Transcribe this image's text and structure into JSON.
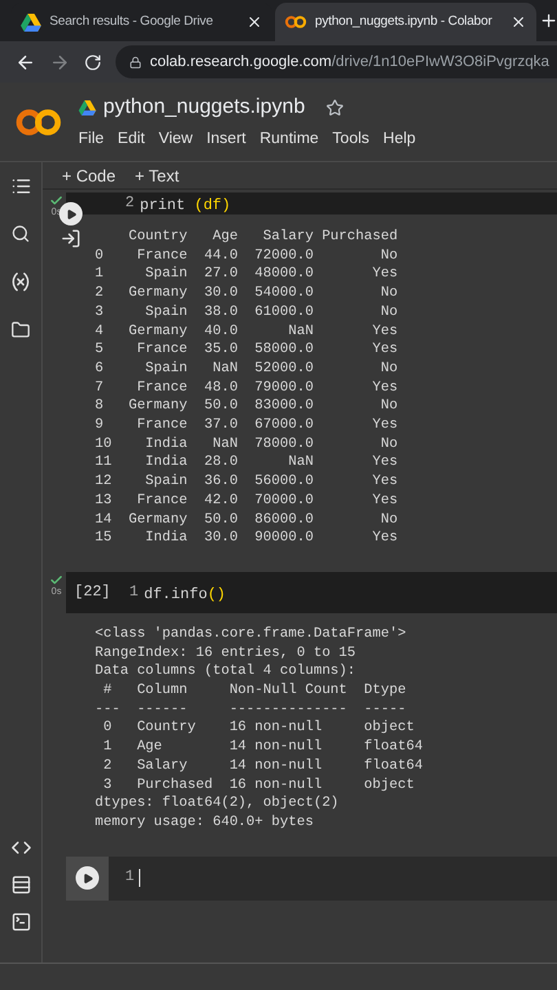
{
  "browser_tabs": [
    {
      "title": "Search results - Google Drive",
      "kind": "drive",
      "selected": false
    },
    {
      "title": "python_nuggets.ipynb - Colabor",
      "kind": "colab",
      "selected": true
    }
  ],
  "address_bar": {
    "host": "colab.research.google.com",
    "path": "/drive/1n10ePIwW3O8iPvgrzqka"
  },
  "notebook": {
    "title": "python_nuggets.ipynb",
    "menu": [
      "File",
      "Edit",
      "View",
      "Insert",
      "Runtime",
      "Tools",
      "Help"
    ]
  },
  "toolbar": [
    "+ Code",
    "+ Text"
  ],
  "cells": [
    {
      "kind": "scrolled",
      "status": "0s",
      "line_number": "2",
      "code": [
        {
          "text": "print ",
          "kind": "plain"
        },
        {
          "text": "(df)",
          "kind": "bracket"
        }
      ],
      "output": [
        "    Country   Age   Salary Purchased",
        "0    France  44.0  72000.0        No",
        "1     Spain  27.0  48000.0       Yes",
        "2   Germany  30.0  54000.0        No",
        "3     Spain  38.0  61000.0        No",
        "4   Germany  40.0      NaN       Yes",
        "5    France  35.0  58000.0       Yes",
        "6     Spain   NaN  52000.0        No",
        "7    France  48.0  79000.0       Yes",
        "8   Germany  50.0  83000.0        No",
        "9    France  37.0  67000.0       Yes",
        "10    India   NaN  78000.0        No",
        "11    India  28.0      NaN       Yes",
        "12    Spain  36.0  56000.0       Yes",
        "13   France  42.0  70000.0       Yes",
        "14  Germany  50.0  86000.0        No",
        "15    India  30.0  90000.0       Yes"
      ]
    },
    {
      "kind": "executed",
      "status": "0s",
      "exec_count": "[22]",
      "line_number": "1",
      "code": [
        {
          "text": "df.info",
          "kind": "plain"
        },
        {
          "text": "()",
          "kind": "bracket"
        }
      ],
      "output": [
        "<class 'pandas.core.frame.DataFrame'>",
        "RangeIndex: 16 entries, 0 to 15",
        "Data columns (total 4 columns):",
        " #   Column     Non-Null Count  Dtype",
        "---  ------     --------------  -----",
        " 0   Country    16 non-null     object",
        " 1   Age        14 non-null     float64",
        " 2   Salary     14 non-null     float64",
        " 3   Purchased  16 non-null     object",
        "dtypes: float64(2), object(2)",
        "memory usage: 640.0+ bytes"
      ]
    },
    {
      "kind": "active",
      "line_number": "1"
    }
  ]
}
